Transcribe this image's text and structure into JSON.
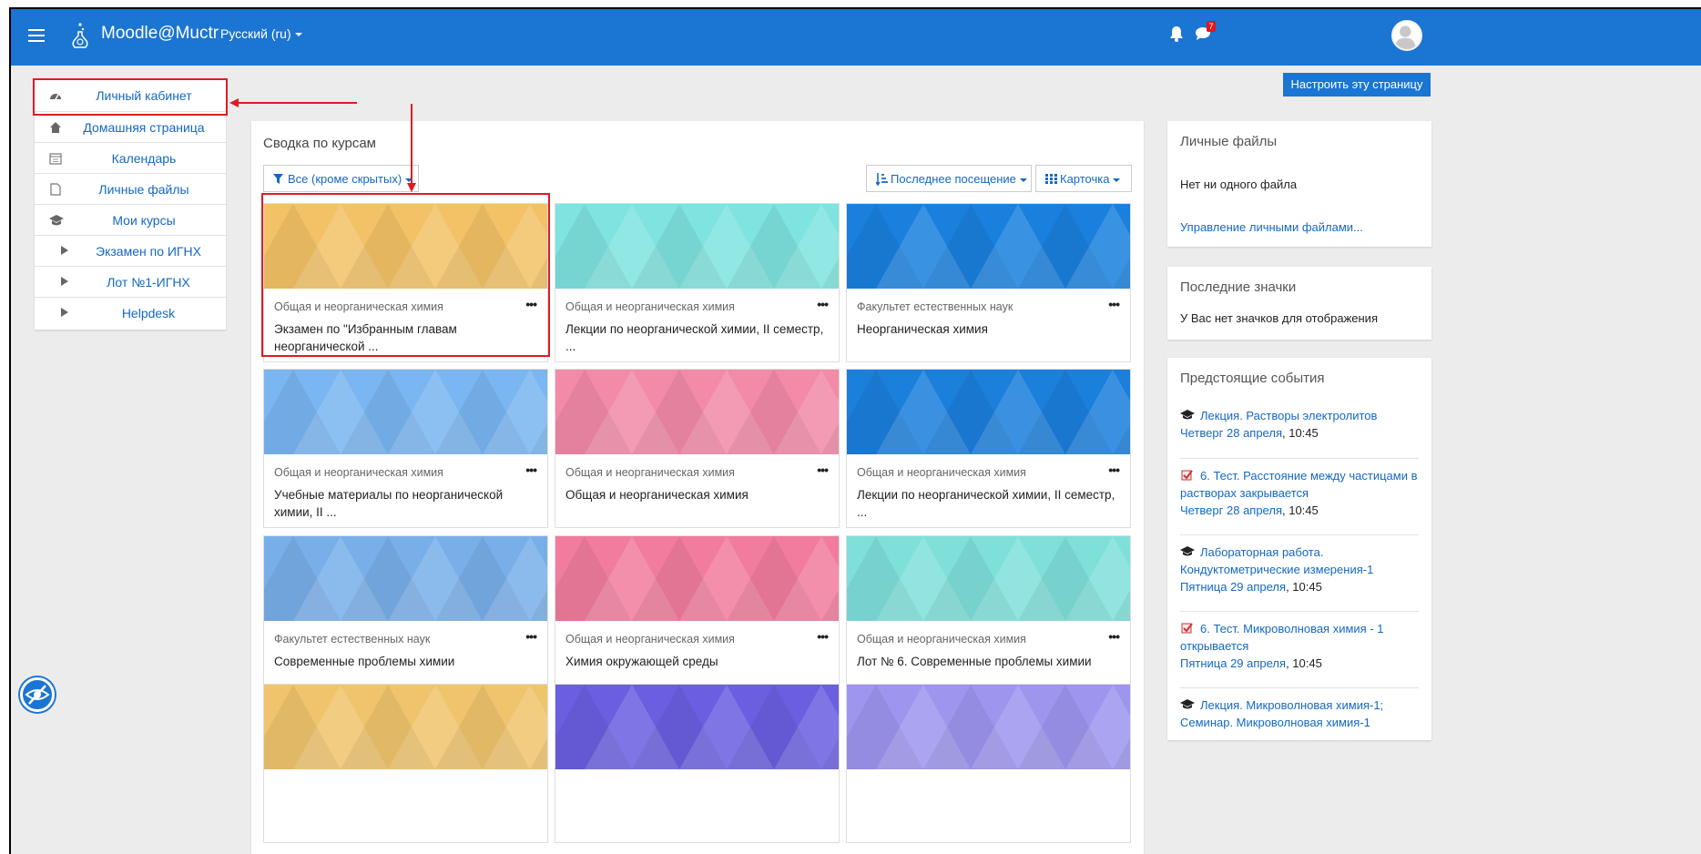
{
  "header": {
    "site_name": "Moodle@Muctr",
    "language": "Русский ‎(ru)‎",
    "message_count": "7"
  },
  "toolbar": {
    "customize_label": "Настроить эту страницу"
  },
  "sidebar": {
    "items": [
      {
        "label": "Личный кабинет",
        "icon": "dashboard-icon"
      },
      {
        "label": "Домашняя страница",
        "icon": "home-icon"
      },
      {
        "label": "Календарь",
        "icon": "calendar-icon"
      },
      {
        "label": "Личные файлы",
        "icon": "file-icon"
      },
      {
        "label": "Мои курсы",
        "icon": "graduation-cap-icon"
      },
      {
        "label": "Экзамен по ИГНХ",
        "icon": "play-icon"
      },
      {
        "label": "Лот №1-ИГНХ",
        "icon": "play-icon"
      },
      {
        "label": "Helpdesk",
        "icon": "play-icon"
      }
    ]
  },
  "main": {
    "title": "Сводка по курсам",
    "filter_label": "Все (кроме скрытых)",
    "sort_label": "Последнее посещение",
    "view_label": "Карточка",
    "courses": [
      {
        "category": "Общая и неорганическая химия",
        "title": "Экзамен по \"Избранным главам неорганической ...",
        "color": "#f3c267"
      },
      {
        "category": "Общая и неорганическая химия",
        "title": "Лекции по неорганической химии, II семестр, ...",
        "color": "#7fe3df"
      },
      {
        "category": "Факультет естественных наук",
        "title": "Неорганическая химия",
        "color": "#1a80de"
      },
      {
        "category": "Общая и неорганическая химия",
        "title": "Учебные материалы по неорганической химии, II ...",
        "color": "#7ab6f2"
      },
      {
        "category": "Общая и неорганическая химия",
        "title": "Общая и неорганическая химия",
        "color": "#f28aa8"
      },
      {
        "category": "Общая и неорганическая химия",
        "title": "Лекции по неорганической химии, II семестр, ...",
        "color": "#1b7fdc"
      },
      {
        "category": "Факультет естественных наук",
        "title": "Современные проблемы химии",
        "color": "#79afe9"
      },
      {
        "category": "Общая и неорганическая химия",
        "title": "Химия окружающей среды",
        "color": "#f17c9e"
      },
      {
        "category": "Общая и неорганическая химия",
        "title": "Лот № 6. Современные проблемы химии",
        "color": "#7fe0da"
      },
      {
        "category": "",
        "title": "",
        "color": "#f0c46d"
      },
      {
        "category": "",
        "title": "",
        "color": "#6a5fe0"
      },
      {
        "category": "",
        "title": "",
        "color": "#9e95ee"
      }
    ]
  },
  "private_files": {
    "title": "Личные файлы",
    "empty_text": "Нет ни одного файла",
    "manage_link": "Управление личными файлами..."
  },
  "badges": {
    "title": "Последние значки",
    "empty_text": "У Вас нет значков для отображения"
  },
  "events": {
    "title": "Предстоящие события",
    "items": [
      {
        "icon": "graduation-cap-icon",
        "name": "Лекция. Растворы электролитов",
        "date": "Четверг 28 апреля",
        "time": ", 10:45"
      },
      {
        "icon": "quiz-icon",
        "name": "6. Тест. Расстояние между частицами в растворах закрывается",
        "date": "Четверг 28 апреля",
        "time": ", 10:45"
      },
      {
        "icon": "graduation-cap-icon",
        "name": "Лабораторная работа. Кондуктометрические измерения-1",
        "date": "Пятница 29 апреля",
        "time": ", 10:45"
      },
      {
        "icon": "quiz-icon",
        "name": "6. Тест. Микроволновая химия - 1 открывается",
        "date": "Пятница 29 апреля",
        "time": ", 10:45"
      },
      {
        "icon": "graduation-cap-icon",
        "name": "Лекция. Микроволновая химия-1; Семинар. Микроволновая химия-1",
        "date": "",
        "time": ""
      }
    ]
  },
  "colors": {
    "brand": "#1b75d2",
    "link": "#1468c4",
    "annotation": "#e01b24"
  }
}
